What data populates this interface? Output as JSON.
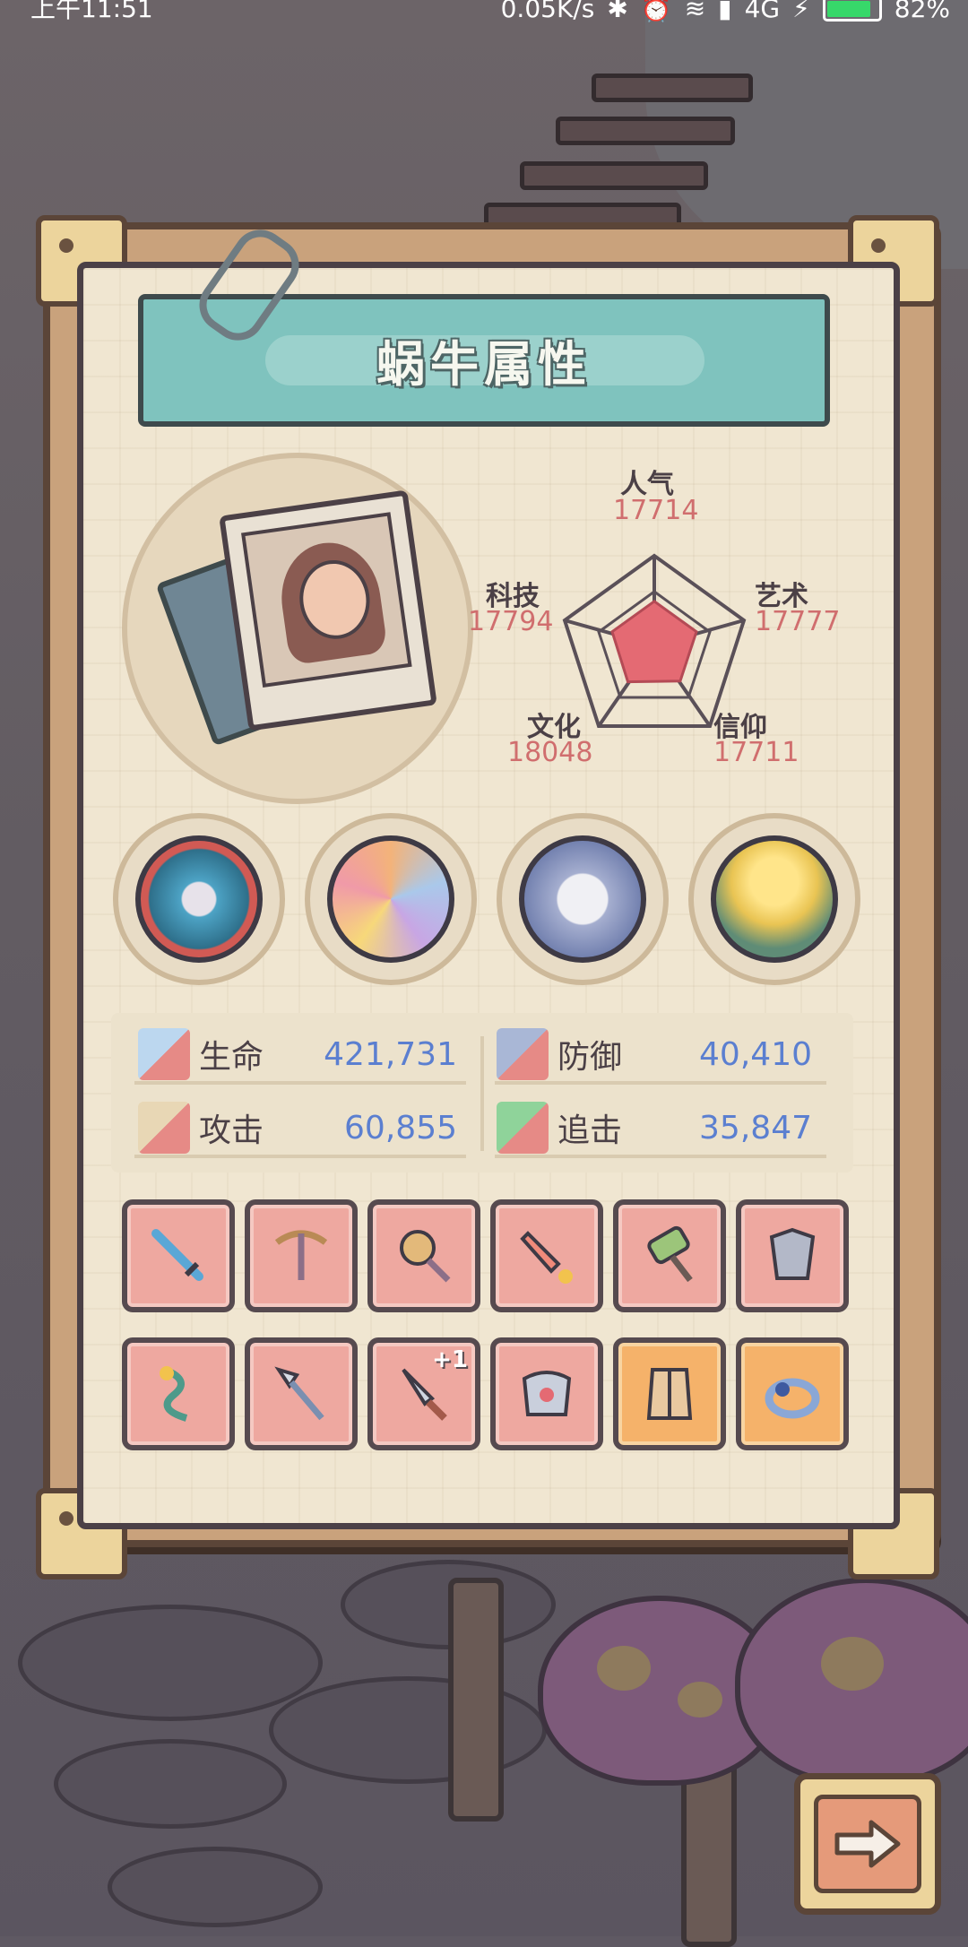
{
  "status_bar": {
    "time": "上午11:51",
    "network_speed": "0.05K/s",
    "network_type": "4G",
    "battery": "82%"
  },
  "panel": {
    "title": "蜗牛属性"
  },
  "attributes": {
    "popularity": {
      "label": "人气",
      "value": "17714"
    },
    "art": {
      "label": "艺术",
      "value": "17777"
    },
    "faith": {
      "label": "信仰",
      "value": "17711"
    },
    "culture": {
      "label": "文化",
      "value": "18048"
    },
    "technology": {
      "label": "科技",
      "value": "17794"
    }
  },
  "relics": [
    {
      "icon": "serpent-relic-icon"
    },
    {
      "icon": "shell-relic-icon"
    },
    {
      "icon": "compass-relic-icon"
    },
    {
      "icon": "torch-relic-icon"
    }
  ],
  "combat_stats": {
    "life": {
      "label": "生命",
      "value": "421,731"
    },
    "defense": {
      "label": "防御",
      "value": "40,410"
    },
    "attack": {
      "label": "攻击",
      "value": "60,855"
    },
    "pursuit": {
      "label": "追击",
      "value": "35,847"
    }
  },
  "equipment_row1": [
    {
      "icon": "sword-icon"
    },
    {
      "icon": "crossbow-icon"
    },
    {
      "icon": "mace-icon"
    },
    {
      "icon": "rocket-blade-icon"
    },
    {
      "icon": "hammer-icon"
    },
    {
      "icon": "armor-icon"
    }
  ],
  "equipment_row2": [
    {
      "icon": "serpent-staff-icon"
    },
    {
      "icon": "spear-icon"
    },
    {
      "icon": "dagger-icon",
      "badge": "+1"
    },
    {
      "icon": "chest-armor-icon"
    },
    {
      "icon": "vest-icon"
    },
    {
      "icon": "ring-icon"
    }
  ],
  "colors": {
    "stat_value": "#5b7fd0",
    "attribute_value": "#d06e6e",
    "slot_red": "#eea8a0",
    "slot_gold": "#f5b26a",
    "title_banner": "#7fc3be"
  },
  "radar_values": [
    17714,
    17777,
    17711,
    18048,
    17794
  ]
}
